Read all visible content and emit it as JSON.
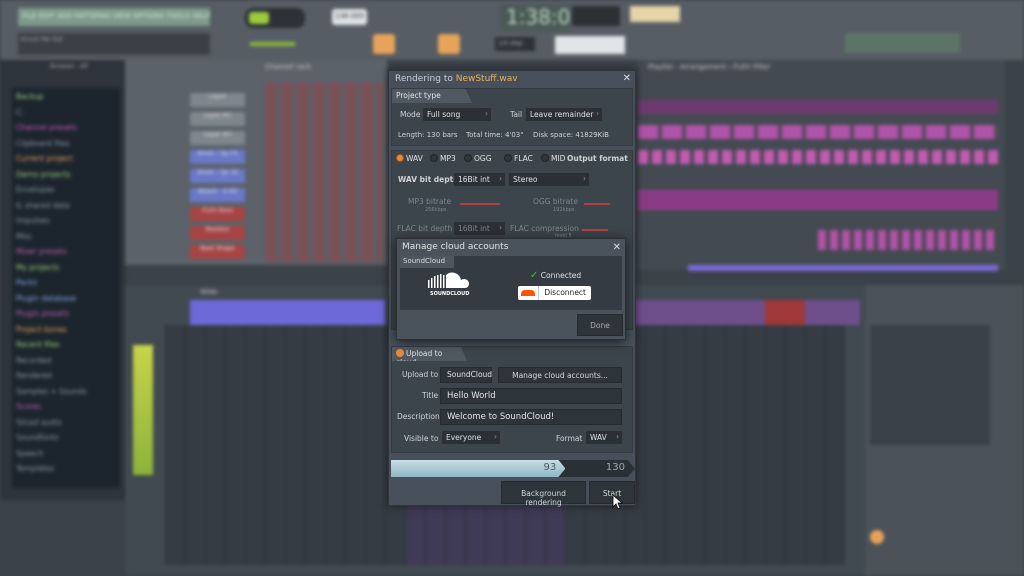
{
  "app": {
    "menu": "FILE EDIT ADD PATTERNS VIEW OPTIONS TOOLS HELP",
    "hint": "Knock Me Out",
    "time": "1:38:03",
    "snap": "1/4 step",
    "tempo": "138.000",
    "channel_rack_title": "Channel rack",
    "playlist_title": "Playlist - Arrangement › FLEX Filter",
    "mixer_title": "Wide",
    "browser_title": "Browser - All",
    "browser_items": [
      "Backup",
      "C:",
      "Channel presets",
      "Clipboard files",
      "Current project",
      "Demo projects",
      "Envelopes",
      "IL shared data",
      "Impulses",
      "Misc",
      "Mixer presets",
      "My projects",
      "Packs",
      "Plugin database",
      "Plugin presets",
      "Project bones",
      "Recent files",
      "Recorded",
      "Rendered",
      "Samples + Sounds",
      "Scores",
      "Sliced audio",
      "Soundfonts",
      "Speech",
      "Templates"
    ],
    "browser_colors": [
      "#9fd07a",
      "#8a96a0",
      "#c45fb5",
      "#8a96a0",
      "#e8a35a",
      "#9fd07a",
      "#8a96a0",
      "#8a96a0",
      "#8a96a0",
      "#8a96a0",
      "#c45fb5",
      "#9fd07a",
      "#8aa8e0",
      "#8aa8e0",
      "#c45fb5",
      "#e8a35a",
      "#9fd07a",
      "#8a96a0",
      "#8a96a0",
      "#8a96a0",
      "#c45fb5",
      "#8a96a0",
      "#8a96a0",
      "#8a96a0",
      "#8a96a0"
    ],
    "channels": [
      "Layer",
      "Layer #2",
      "Layer #3",
      "Amen - tip FX",
      "Amen - tip 1b",
      "Attack - 4 Hit",
      "FLEX Bass",
      "Resistor",
      "Beat Shape"
    ]
  },
  "render": {
    "title_prefix": "Rendering to ",
    "filename": "NewStuff.wav",
    "project_type": {
      "header": "Project type",
      "mode_label": "Mode",
      "mode": "Full song",
      "tail_label": "Tail",
      "tail": "Leave remainder",
      "length": "Length: 130 bars",
      "total_time": "Total time: 4'03\"",
      "disk_space": "Disk space: 41829KiB"
    },
    "output": {
      "formats": [
        "WAV",
        "MP3",
        "OGG",
        "FLAC",
        "MID"
      ],
      "selected": "WAV",
      "header": "Output format",
      "wav_depth_label": "WAV bit depth",
      "wav_depth": "16Bit int",
      "channels": "Stereo",
      "mp3_label": "MP3 bitrate",
      "mp3_value": "256kbps",
      "ogg_label": "OGG bitrate",
      "ogg_value": "192kbps",
      "flac_depth_label": "FLAC bit depth",
      "flac_depth": "16Bit int",
      "flac_comp_label": "FLAC compression",
      "flac_comp_value": "level 5"
    },
    "upload": {
      "header": "Upload to cloud",
      "upload_to_label": "Upload to",
      "upload_to": "SoundCloud",
      "manage_btn": "Manage cloud accounts...",
      "title_label": "Title",
      "title": "Hello World",
      "desc_label": "Description",
      "desc": "Welcome to SoundCloud!",
      "visible_label": "Visible to",
      "visible": "Everyone",
      "format_label": "Format",
      "format": "WAV"
    },
    "progress": {
      "current": "93",
      "total": "130",
      "fraction": 0.715
    },
    "bg_render_btn": "Background rendering",
    "start_btn": "Start"
  },
  "cloud_dialog": {
    "title": "Manage cloud accounts",
    "service": "SoundCloud",
    "logo_text": "SOUNDCLOUD",
    "status": "Connected",
    "disconnect": "Disconnect",
    "done": "Done",
    "brand_color": "#ff5500",
    "status_color": "#3cc83c"
  }
}
